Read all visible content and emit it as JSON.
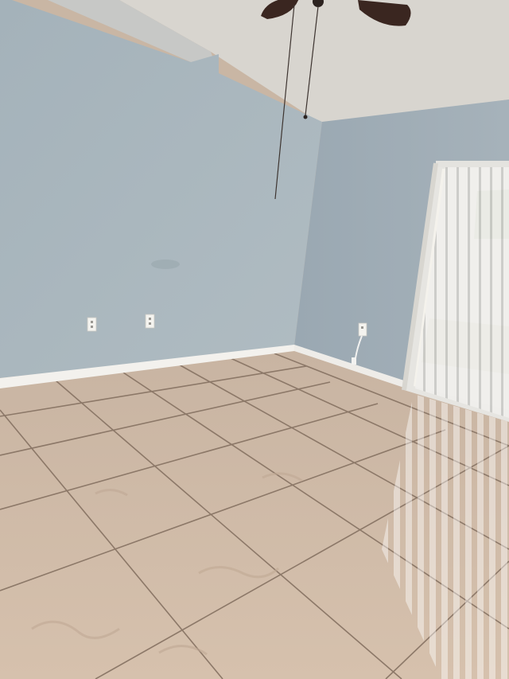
{
  "scene": {
    "kind": "empty-room-photo",
    "objects": [
      "ceiling-fan",
      "pull-chain",
      "electrical-outlet",
      "electrical-outlet",
      "electrical-outlet",
      "vertical-blinds",
      "sliding-glass-door",
      "baseboard",
      "tile-floor"
    ]
  },
  "colors": {
    "ceiling": "#d9d6d1",
    "wall_left": "#a9b6bd",
    "wall_right": "#9fadb6",
    "baseboard": "#f2f0ec",
    "tile": "#d2bca8",
    "grout": "#8f7c6b",
    "blinds": "#eeeeec",
    "fan_blade": "#3a2620",
    "window_light": "#f6f4ee"
  }
}
